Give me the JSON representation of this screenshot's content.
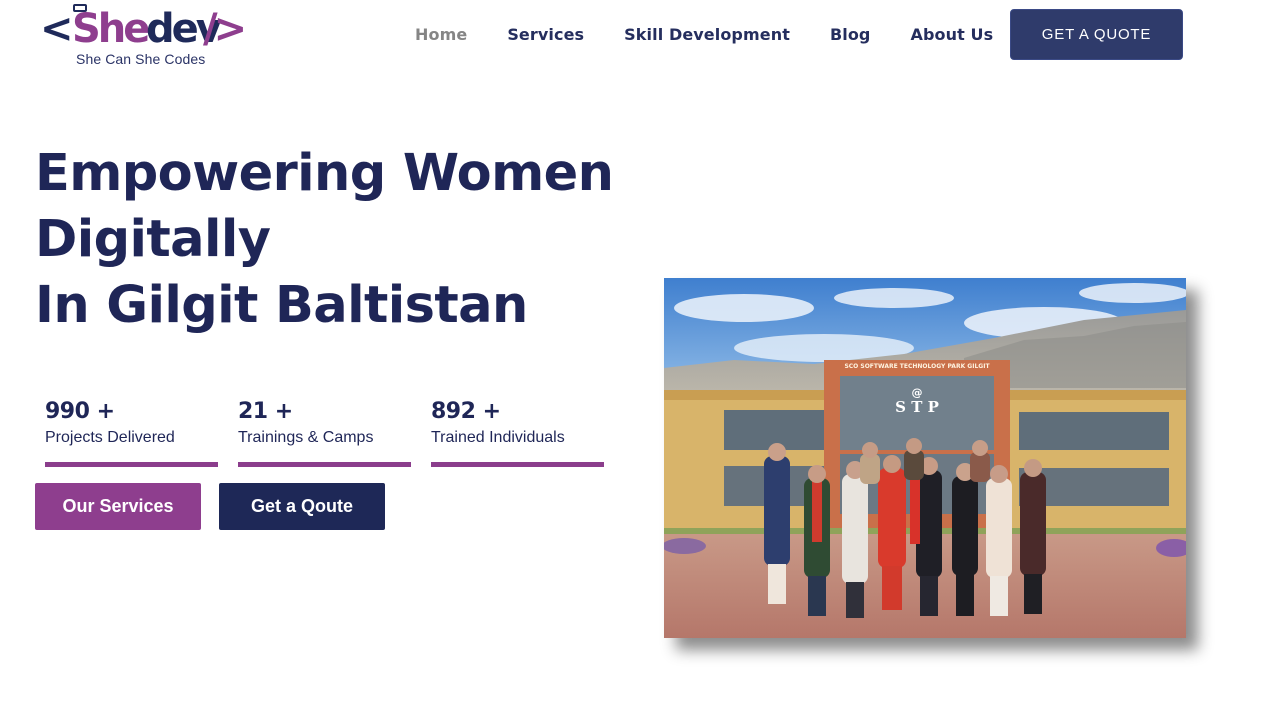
{
  "brand": {
    "logo_text_open": "<",
    "logo_text_she": "She",
    "logo_text_dev": "dev",
    "logo_text_close": "/>",
    "tagline": "She Can She Codes",
    "colors": {
      "primary": "#1f2657",
      "accent": "#8e3e8e"
    }
  },
  "nav": {
    "items": [
      {
        "label": "Home",
        "active": true
      },
      {
        "label": "Services"
      },
      {
        "label": "Skill Development"
      },
      {
        "label": "Blog"
      },
      {
        "label": "About Us"
      }
    ],
    "cta": "GET A QUOTE"
  },
  "hero": {
    "title_line1": "Empowering Women Digitally",
    "title_line2": "In Gilgit Baltistan",
    "stats": [
      {
        "value": "990 +",
        "label": "Projects Delivered",
        "progress": 1.0
      },
      {
        "value": "21 +",
        "label": "Trainings & Camps",
        "progress": 1.0
      },
      {
        "value": "892 +",
        "label": "Trained Individuals",
        "progress": 1.0
      }
    ],
    "buttons": {
      "services": "Our Services",
      "quote": "Get a Qoute"
    },
    "photo": {
      "sign_top": "SCO SOFTWARE TECHNOLOGY PARK GILGIT",
      "sign_at": "@",
      "sign_main": "S T P"
    }
  }
}
